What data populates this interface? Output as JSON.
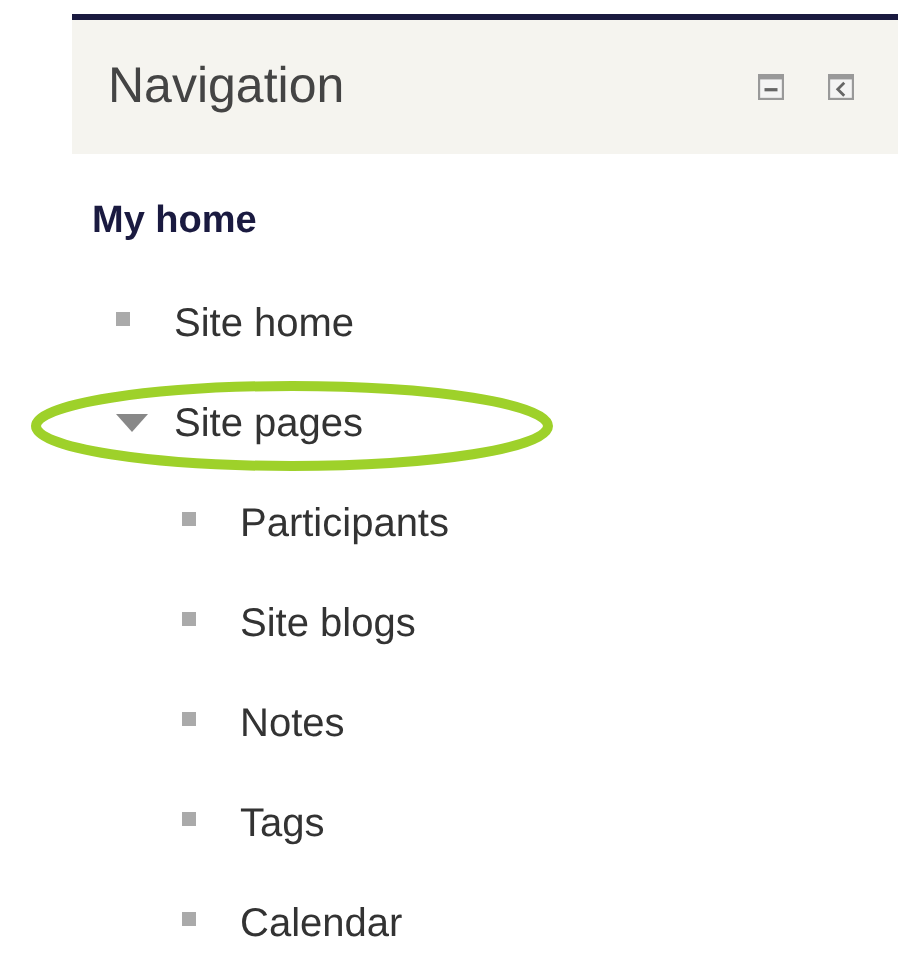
{
  "block": {
    "title": "Navigation",
    "controls": [
      {
        "kind": "collapse"
      },
      {
        "kind": "dock"
      }
    ]
  },
  "root": {
    "label": "My home"
  },
  "items": [
    {
      "label": "Site home",
      "kind": "leaf",
      "highlighted": false
    },
    {
      "label": "Site pages",
      "kind": "branch",
      "expanded": true,
      "highlighted": true,
      "children": [
        {
          "label": "Participants",
          "kind": "leaf",
          "highlighted": false
        },
        {
          "label": "Site blogs",
          "kind": "leaf",
          "highlighted": false
        },
        {
          "label": "Notes",
          "kind": "leaf",
          "highlighted": false
        },
        {
          "label": "Tags",
          "kind": "leaf",
          "highlighted": false
        },
        {
          "label": "Calendar",
          "kind": "leaf",
          "highlighted": false
        }
      ]
    }
  ]
}
